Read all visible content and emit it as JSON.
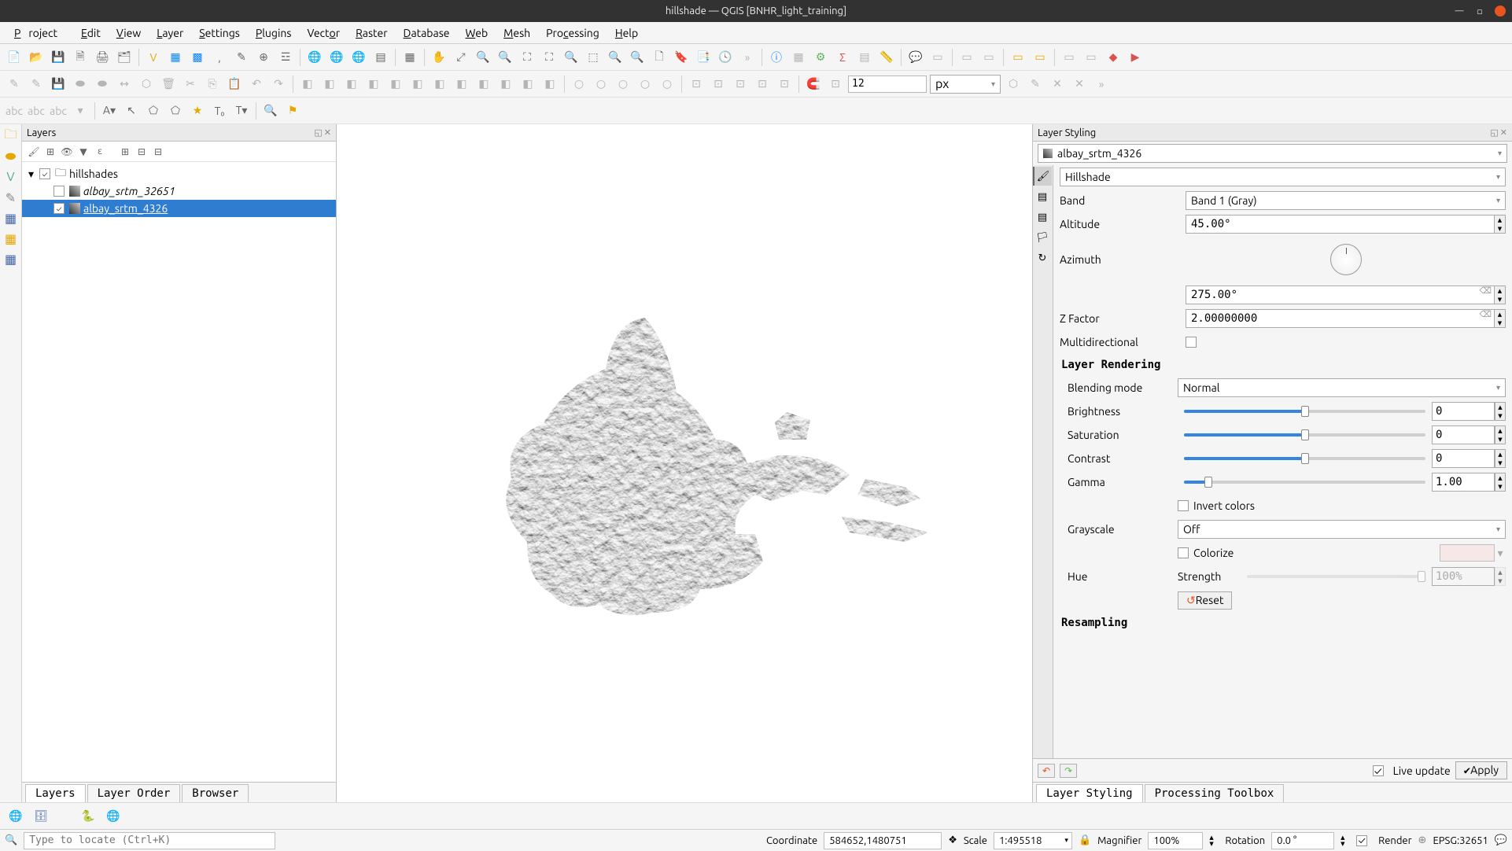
{
  "window": {
    "title": "hillshade — QGIS [BNHR_light_training]"
  },
  "menubar": [
    "Project",
    "Edit",
    "View",
    "Layer",
    "Settings",
    "Plugins",
    "Vector",
    "Raster",
    "Database",
    "Web",
    "Mesh",
    "Processing",
    "Help"
  ],
  "toolbar2": {
    "num_input": "12",
    "unit": "px"
  },
  "layers_panel": {
    "title": "Layers",
    "group": {
      "name": "hillshades",
      "checked": true
    },
    "items": [
      {
        "name": "albay_srtm_32651",
        "checked": false,
        "selected": false
      },
      {
        "name": "albay_srtm_4326",
        "checked": true,
        "selected": true
      }
    ],
    "tabs": [
      "Layers",
      "Layer Order",
      "Browser"
    ]
  },
  "style_panel": {
    "title": "Layer Styling",
    "layer": "albay_srtm_4326",
    "renderer": "Hillshade",
    "band_label": "Band",
    "band_value": "Band 1 (Gray)",
    "altitude_label": "Altitude",
    "altitude_value": "45.00°",
    "azimuth_label": "Azimuth",
    "azimuth_value": "275.00°",
    "zfactor_label": "Z Factor",
    "zfactor_value": "2.00000000",
    "multidir_label": "Multidirectional",
    "rendering_header": "Layer Rendering",
    "blending_label": "Blending mode",
    "blending_value": "Normal",
    "brightness_label": "Brightness",
    "brightness_value": "0",
    "saturation_label": "Saturation",
    "saturation_value": "0",
    "contrast_label": "Contrast",
    "contrast_value": "0",
    "gamma_label": "Gamma",
    "gamma_value": "1.00",
    "invert_label": "Invert colors",
    "grayscale_label": "Grayscale",
    "grayscale_value": "Off",
    "colorize_label": "Colorize",
    "hue_label": "Hue",
    "strength_label": "Strength",
    "strength_value": "100%",
    "reset_label": "Reset",
    "resampling_header": "Resampling",
    "live_update_label": "Live update",
    "apply_label": "Apply",
    "tabs": [
      "Layer Styling",
      "Processing Toolbox"
    ]
  },
  "statusbar": {
    "locator_placeholder": "Type to locate (Ctrl+K)",
    "coordinate_label": "Coordinate",
    "coordinate_value": "584652,1480751",
    "scale_label": "Scale",
    "scale_value": "1:495518",
    "magnifier_label": "Magnifier",
    "magnifier_value": "100%",
    "rotation_label": "Rotation",
    "rotation_value": "0.0 °",
    "render_label": "Render",
    "crs": "EPSG:32651"
  }
}
